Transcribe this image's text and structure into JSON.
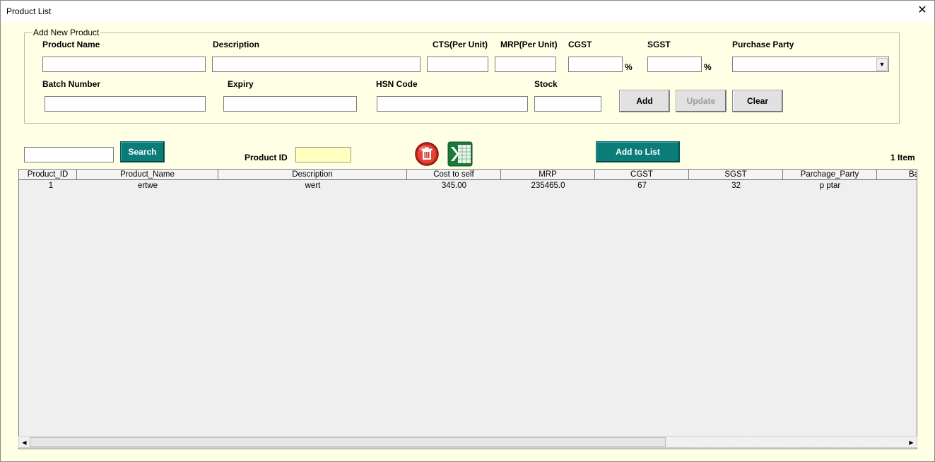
{
  "window": {
    "title": "Product List",
    "close_glyph": "✕"
  },
  "form": {
    "legend": "Add New Product",
    "labels": {
      "product_name": "Product Name",
      "description": "Description",
      "cts": "CTS(Per Unit)",
      "mrp": "MRP(Per Unit)",
      "cgst": "CGST",
      "sgst": "SGST",
      "purchase_party": "Purchase Party",
      "batch_number": "Batch Number",
      "expiry": "Expiry",
      "hsn_code": "HSN Code",
      "stock": "Stock"
    },
    "percent_sign": "%",
    "values": {
      "product_name": "",
      "description": "",
      "cts": "",
      "mrp": "",
      "cgst": "",
      "sgst": "",
      "purchase_party": "",
      "batch_number": "",
      "expiry": "",
      "hsn_code": "",
      "stock": ""
    },
    "buttons": {
      "add": "Add",
      "update": "Update",
      "clear": "Clear"
    }
  },
  "toolbar": {
    "search_value": "",
    "search_button": "Search",
    "product_id_label": "Product ID",
    "product_id_value": "",
    "add_to_list_button": "Add to List",
    "item_count": "1 Item"
  },
  "list": {
    "columns": [
      "Product_ID",
      "Product_Name",
      "Description",
      "Cost to self",
      "MRP",
      "CGST",
      "SGST",
      "Parchage_Party",
      "Batch"
    ],
    "rows": [
      [
        "1",
        "ertwe",
        "wert",
        "345.00",
        "235465.0",
        "67",
        "32",
        "p ptar",
        ""
      ]
    ]
  },
  "colors": {
    "accent_teal": "#0b7d78",
    "background": "#ffffe6",
    "product_id_field": "#ffffc0"
  },
  "icons": {
    "delete": "delete-icon",
    "excel": "excel-icon",
    "combo_arrow": "chevron-down-icon",
    "scroll_left": "scroll-left-icon",
    "scroll_right": "scroll-right-icon"
  }
}
